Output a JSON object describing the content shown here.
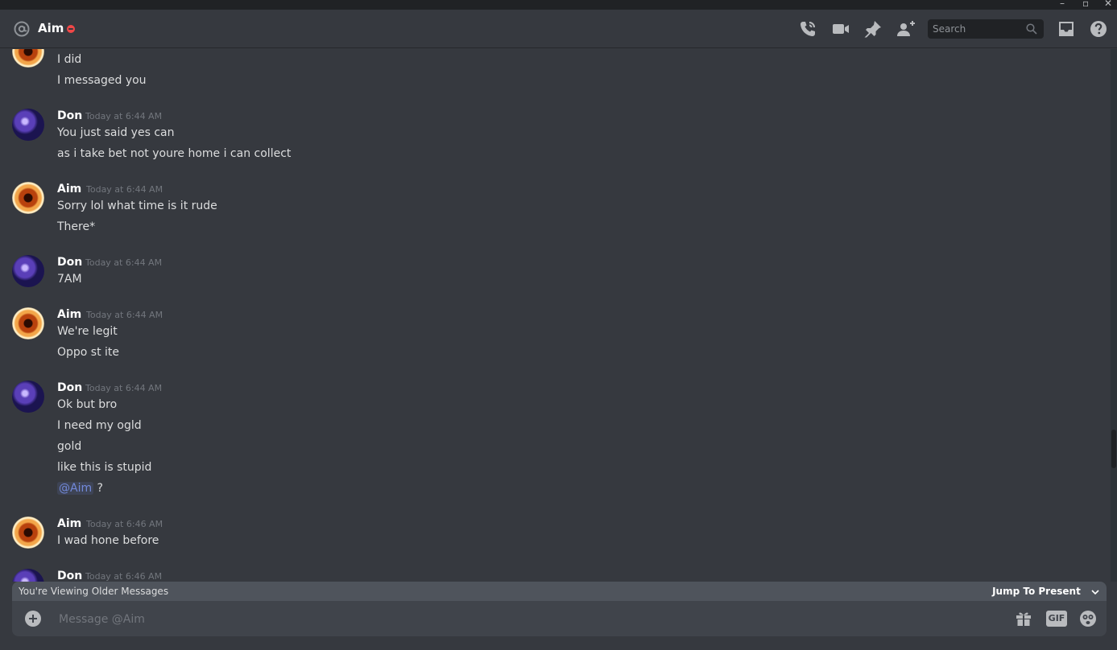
{
  "window": {
    "minimize": "–",
    "maximize": "▫",
    "close": "✕"
  },
  "header": {
    "channel_name": "Aim",
    "status": "do-not-disturb",
    "icons": [
      "call-icon",
      "video-icon",
      "pin-icon",
      "add-member-icon",
      "inbox-icon",
      "help-icon"
    ],
    "search_placeholder": "Search"
  },
  "messages": [
    {
      "author": "",
      "timestamp": "",
      "lines": [
        "I did",
        "I messaged you"
      ],
      "avatar": "aim"
    },
    {
      "author": "Don",
      "timestamp": "Today at 6:44 AM",
      "lines": [
        "You just said yes can",
        "as i take bet not youre home i can collect"
      ],
      "avatar": "don"
    },
    {
      "author": "Aim",
      "timestamp": "Today at 6:44 AM",
      "lines": [
        "Sorry lol what time is it rude",
        "There*"
      ],
      "avatar": "aim"
    },
    {
      "author": "Don",
      "timestamp": "Today at 6:44 AM",
      "lines": [
        "7AM"
      ],
      "avatar": "don"
    },
    {
      "author": "Aim",
      "timestamp": "Today at 6:44 AM",
      "lines": [
        "We're legit",
        "Oppo st ite"
      ],
      "avatar": "aim"
    },
    {
      "author": "Don",
      "timestamp": "Today at 6:44 AM",
      "lines": [
        "Ok but bro",
        "I need my ogld",
        "gold",
        "like this is stupid"
      ],
      "mention": "@Aim",
      "mention_suffix": " ?",
      "avatar": "don"
    },
    {
      "author": "Aim",
      "timestamp": "Today at 6:46 AM",
      "lines": [
        "I wad hone before"
      ],
      "avatar": "aim"
    },
    {
      "author": "Don",
      "timestamp": "Today at 6:46 AM",
      "lines": [],
      "avatar": "don"
    }
  ],
  "older_bar": {
    "text": "You're Viewing Older Messages",
    "jump_label": "Jump To Present"
  },
  "composer": {
    "placeholder": "Message @Aim",
    "gif_label": "GIF"
  },
  "colors": {
    "background": "#36393f",
    "status_dnd": "#f04747",
    "mention": "#7289da"
  }
}
